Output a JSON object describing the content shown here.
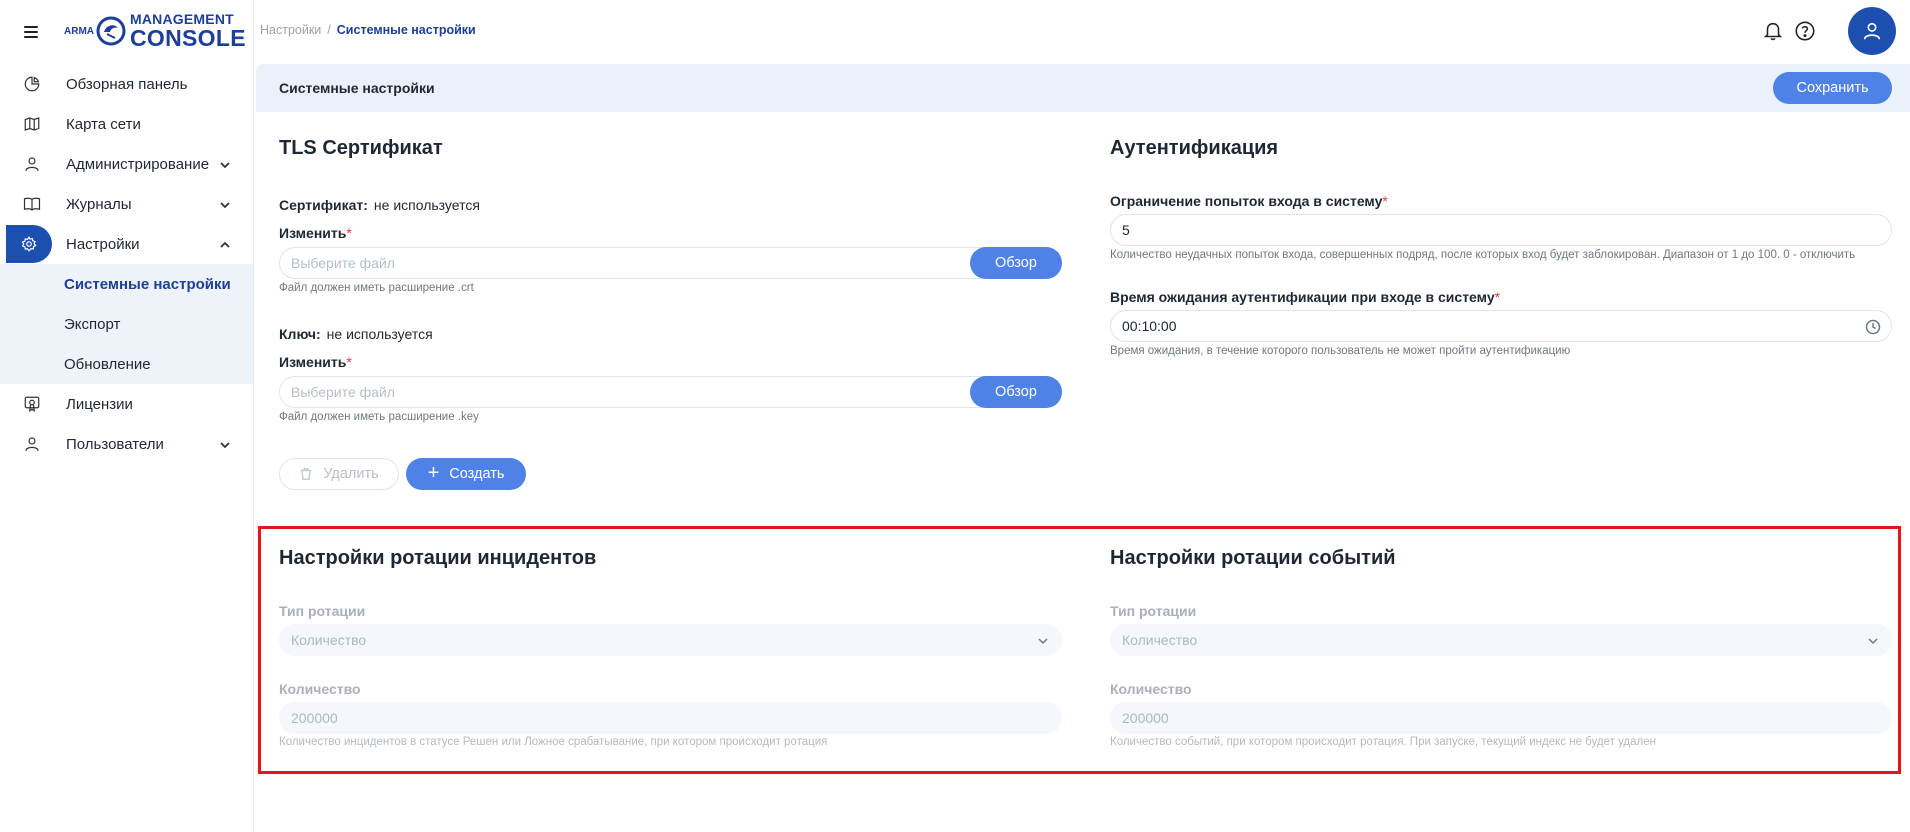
{
  "logo": {
    "small": "ARMA",
    "top": "MANAGEMENT",
    "bottom": "CONSOLE"
  },
  "sidebar": {
    "items": [
      {
        "label": "Обзорная панель"
      },
      {
        "label": "Карта сети"
      },
      {
        "label": "Администрирование"
      },
      {
        "label": "Журналы"
      },
      {
        "label": "Настройки"
      },
      {
        "label": "Лицензии"
      },
      {
        "label": "Пользователи"
      }
    ],
    "subitems": [
      {
        "label": "Системные настройки"
      },
      {
        "label": "Экспорт"
      },
      {
        "label": "Обновление"
      }
    ]
  },
  "breadcrumb": {
    "root": "Настройки",
    "separator": "/",
    "current": "Системные настройки"
  },
  "header": {
    "title": "Системные настройки",
    "save_label": "Сохранить"
  },
  "tls": {
    "title": "TLS Сертификат",
    "cert_label": "Сертификат:",
    "cert_value": "не используется",
    "change_label": "Изменить",
    "required_mark": "*",
    "file_placeholder": "Выберите файл",
    "browse_label": "Обзор",
    "cert_hint": "Файл должен иметь расширение .crt",
    "key_label": "Ключ:",
    "key_value": "не используется",
    "key_hint": "Файл должен иметь расширение .key",
    "delete_label": "Удалить",
    "create_label": "Создать",
    "create_plus": "+"
  },
  "auth": {
    "title": "Аутентификация",
    "attempts_label": "Ограничение попыток входа в систему",
    "attempts_value": "5",
    "attempts_hint": "Количество неудачных попыток входа, совершенных подряд, после которых вход будет заблокирован. Диапазон от 1 до 100. 0 - отключить",
    "timeout_label": "Время ожидания аутентификации при входе в систему",
    "timeout_value": "00:10:00",
    "timeout_hint": "Время ожидания, в течение которого пользователь не может пройти аутентификацию"
  },
  "incidents_rotation": {
    "title": "Настройки ротации инцидентов",
    "type_label": "Тип ротации",
    "type_value": "Количество",
    "count_label": "Количество",
    "count_value": "200000",
    "hint": "Количество инцидентов в статусе Решен или Ложное срабатывание, при котором происходит ротация"
  },
  "events_rotation": {
    "title": "Настройки ротации событий",
    "type_label": "Тип ротации",
    "type_value": "Количество",
    "count_label": "Количество",
    "count_value": "200000",
    "hint": "Количество событий, при котором происходит ротация. При запуске, текущий индекс не будет удален"
  },
  "colors": {
    "brand": "#1d4fb0",
    "accent": "#4f82e6",
    "highlight": "#e8131b"
  }
}
